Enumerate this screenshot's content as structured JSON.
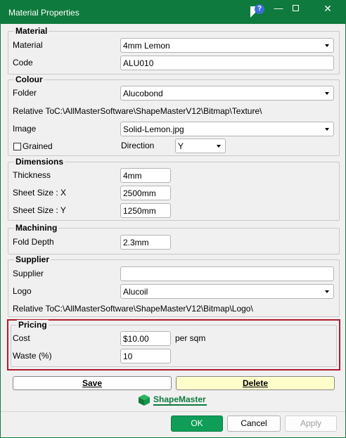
{
  "window": {
    "title": "Material Properties",
    "help_glyph": "?",
    "minimize_glyph": "—",
    "close_glyph": "✕"
  },
  "material": {
    "group_title": "Material",
    "material_label": "Material",
    "material_value": "4mm Lemon",
    "code_label": "Code",
    "code_value": "ALU010"
  },
  "colour": {
    "group_title": "Colour",
    "folder_label": "Folder",
    "folder_value": "Alucobond",
    "relative_to_label": "Relative To",
    "relative_to_value": "C:\\AllMasterSoftware\\ShapeMasterV12\\Bitmap\\Texture\\",
    "image_label": "Image",
    "image_value": "Solid-Lemon.jpg",
    "grained_label": "Grained",
    "direction_label": "Direction",
    "direction_value": "Y"
  },
  "dimensions": {
    "group_title": "Dimensions",
    "thickness_label": "Thickness",
    "thickness_value": "4mm",
    "sheet_x_label": "Sheet Size : X",
    "sheet_x_value": "2500mm",
    "sheet_y_label": "Sheet Size : Y",
    "sheet_y_value": "1250mm"
  },
  "machining": {
    "group_title": "Machining",
    "fold_depth_label": "Fold Depth",
    "fold_depth_value": "2.3mm"
  },
  "supplier": {
    "group_title": "Supplier",
    "supplier_label": "Supplier",
    "supplier_value": "",
    "logo_label": "Logo",
    "logo_value": "Alucoil",
    "relative_to_label": "Relative To",
    "relative_to_value": "C:\\AllMasterSoftware\\ShapeMasterV12\\Bitmap\\Logo\\"
  },
  "pricing": {
    "group_title": "Pricing",
    "cost_label": "Cost",
    "cost_value": "$10.00",
    "cost_unit": "per sqm",
    "waste_label": "Waste (%)",
    "waste_value": "10"
  },
  "actions": {
    "save_label": "Save",
    "delete_label": "Delete"
  },
  "brand": {
    "name_part1": "Shape",
    "name_part2": "Master",
    "color": "#0f7a3d"
  },
  "footer": {
    "ok_label": "OK",
    "cancel_label": "Cancel",
    "apply_label": "Apply"
  },
  "colors": {
    "titlebar": "#0f7a3d",
    "ok_button": "#0f9d58",
    "highlight_border": "#b01c2e",
    "delete_bg": "#ffffcc"
  }
}
